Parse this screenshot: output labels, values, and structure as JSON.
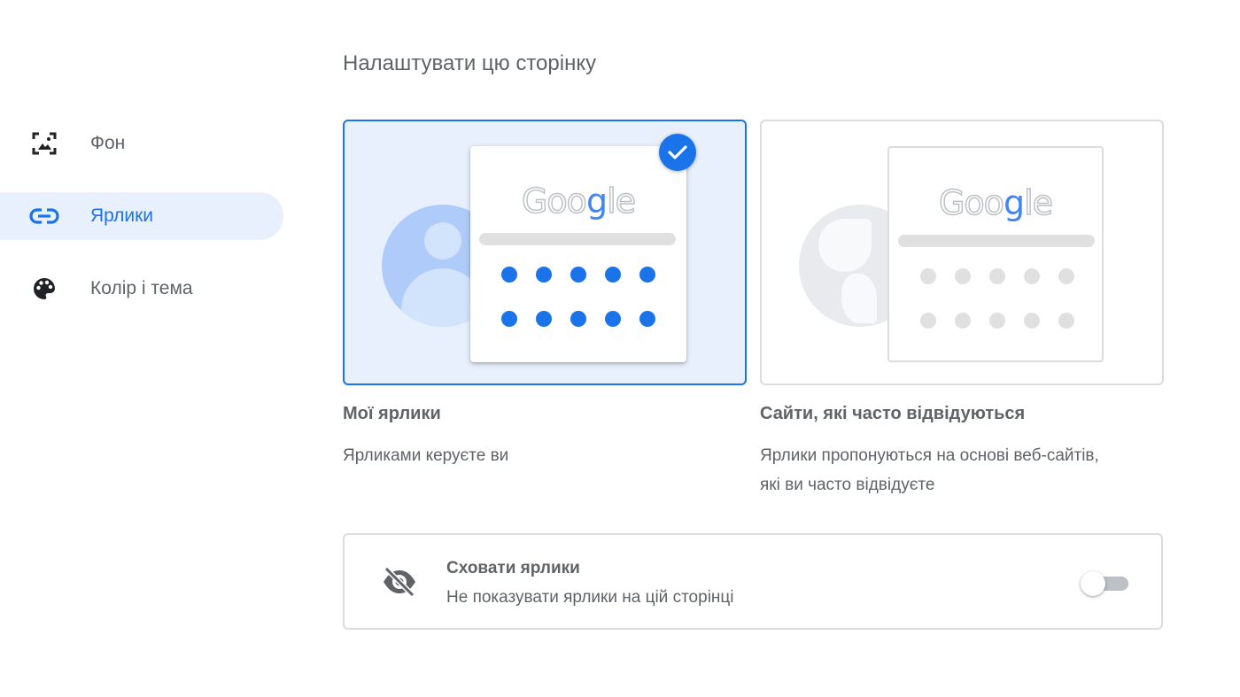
{
  "sidebar": {
    "items": [
      {
        "label": "Фон",
        "icon": "wallpaper-icon",
        "active": false
      },
      {
        "label": "Ярлики",
        "icon": "link-icon",
        "active": true
      },
      {
        "label": "Колір і тема",
        "icon": "palette-icon",
        "active": false
      }
    ]
  },
  "main": {
    "title": "Налаштувати цю сторінку",
    "options": [
      {
        "title": "Мої ярлики",
        "description": "Ярликами керуєте ви",
        "selected": true,
        "preview_logo": "Google",
        "background_icon": "person-icon"
      },
      {
        "title": "Сайти, які часто відвідуються",
        "description": "Ярлики пропонуються на основі веб-сайтів, які ви часто відвідуєте",
        "selected": false,
        "preview_logo": "Google",
        "background_icon": "globe-icon"
      }
    ],
    "hide_shortcuts": {
      "title": "Сховати ярлики",
      "description": "Не показувати ярлики на цій сторінці",
      "icon": "visibility-off-icon",
      "toggle_on": false
    }
  },
  "colors": {
    "accent": "#1a73e8",
    "selected_bg": "#e8f0fe",
    "text": "#5f6368",
    "border": "#dadce0"
  }
}
